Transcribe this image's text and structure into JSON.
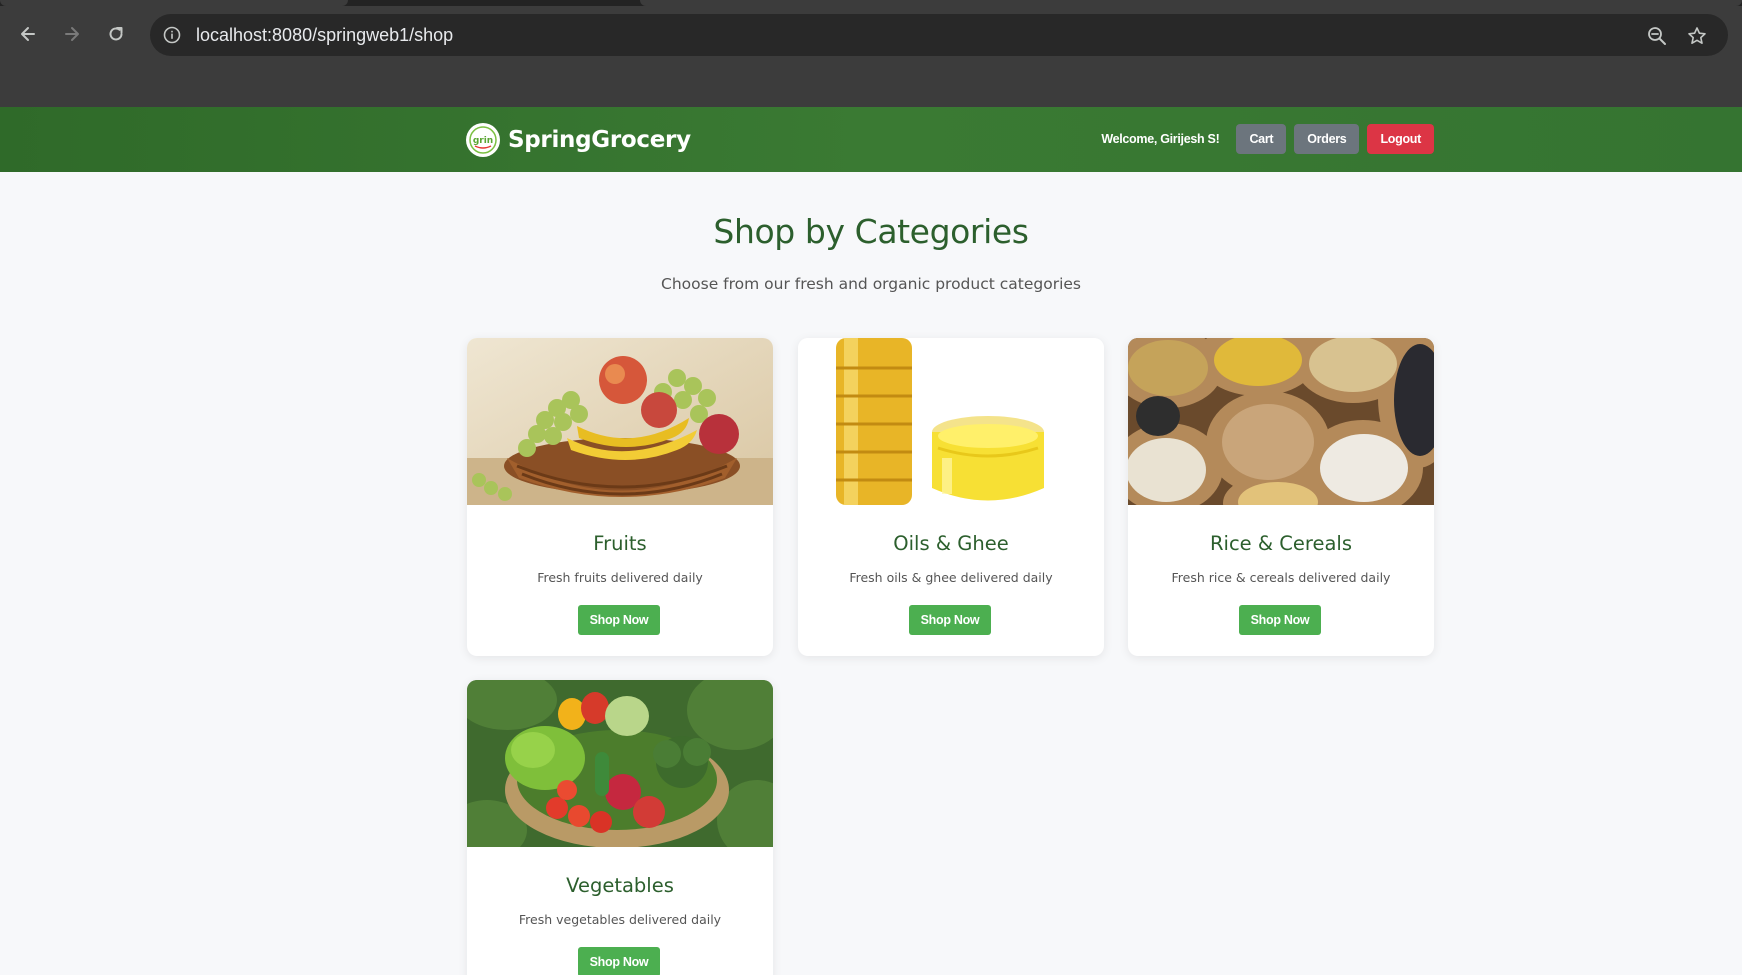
{
  "browser": {
    "url": "localhost:8080/springweb1/shop",
    "icons": {
      "back": "arrow-left",
      "forward": "arrow-right",
      "reload": "reload",
      "info": "info-circle",
      "zoom": "magnifier-minus",
      "bookmark": "star-outline"
    }
  },
  "header": {
    "brand_name": "SpringGrocery",
    "welcome_text": "Welcome, Girijesh S!",
    "cart_label": "Cart",
    "orders_label": "Orders",
    "logout_label": "Logout",
    "colors": {
      "header_bg": "#357431",
      "secondary_btn": "#6c757d",
      "logout_btn": "#dc3545"
    }
  },
  "main": {
    "title": "Shop by Categories",
    "subtitle": "Choose from our fresh and organic product categories",
    "categories": [
      {
        "name": "Fruits",
        "description": "Fresh fruits delivered daily",
        "button_label": "Shop Now"
      },
      {
        "name": "Oils & Ghee",
        "description": "Fresh oils & ghee delivered daily",
        "button_label": "Shop Now"
      },
      {
        "name": "Rice & Cereals",
        "description": "Fresh rice & cereals delivered daily",
        "button_label": "Shop Now"
      },
      {
        "name": "Vegetables",
        "description": "Fresh vegetables delivered daily",
        "button_label": "Shop Now"
      }
    ],
    "colors": {
      "title": "#2c5f2d",
      "button": "#4caf50"
    }
  }
}
